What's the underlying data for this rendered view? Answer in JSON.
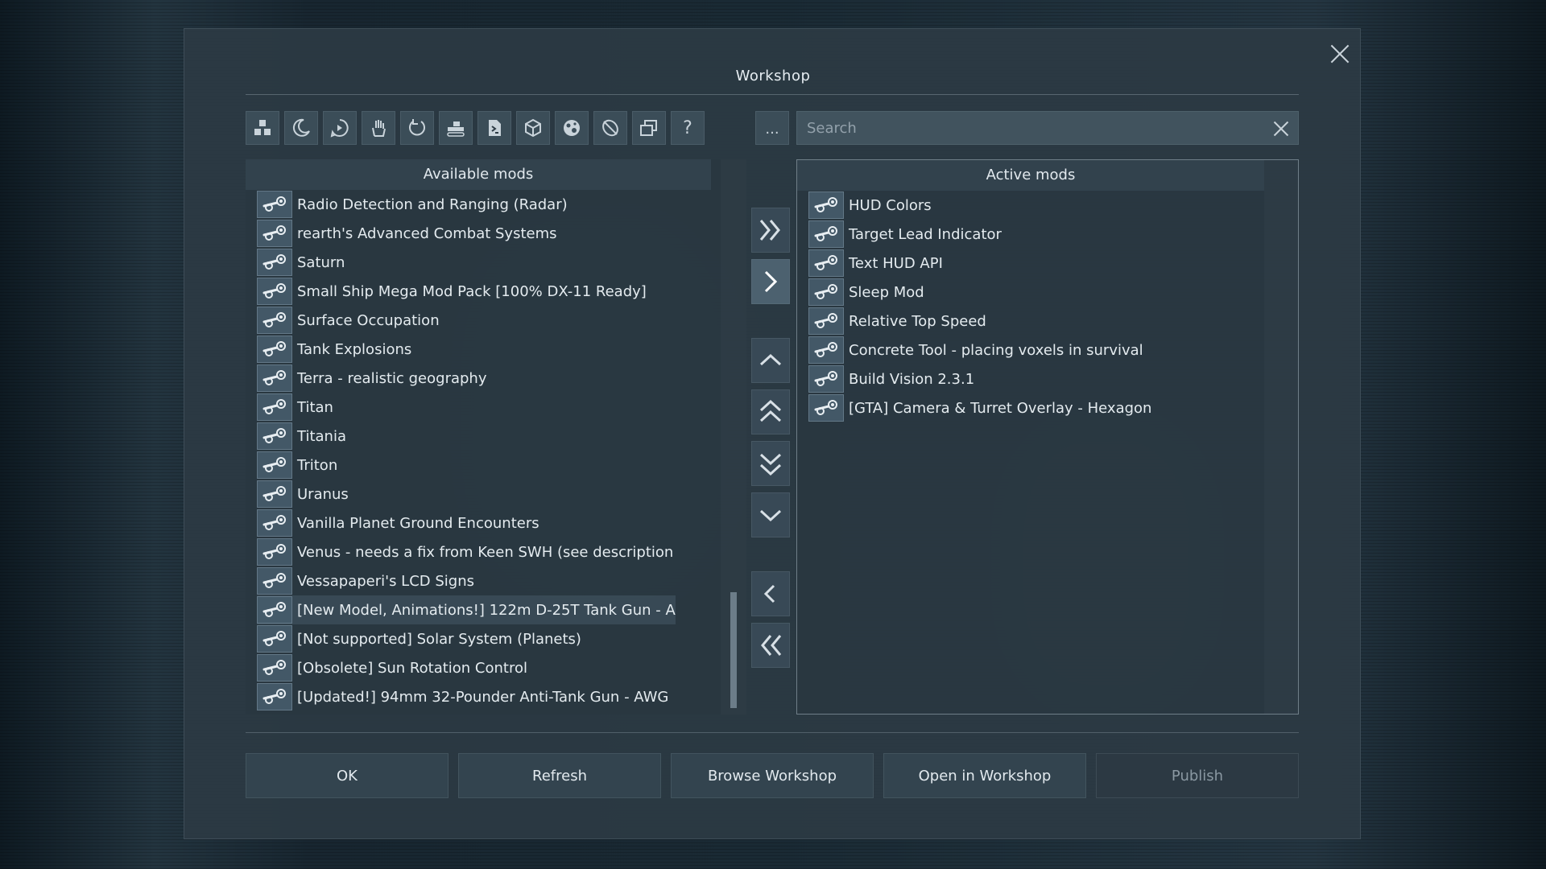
{
  "dialog": {
    "title": "Workshop",
    "close_icon": "close-icon"
  },
  "toolbar": {
    "tools": [
      {
        "name": "blocks-filter-icon"
      },
      {
        "name": "moon-filter-icon"
      },
      {
        "name": "chat-filter-icon"
      },
      {
        "name": "hand-filter-icon"
      },
      {
        "name": "refresh-filter-icon"
      },
      {
        "name": "tank-filter-icon"
      },
      {
        "name": "script-filter-icon"
      },
      {
        "name": "cube-filter-icon"
      },
      {
        "name": "planet-filter-icon"
      },
      {
        "name": "satellite-filter-icon"
      },
      {
        "name": "windows-filter-icon"
      },
      {
        "name": "help-icon",
        "glyph": "?"
      }
    ],
    "more_label": "..."
  },
  "search": {
    "placeholder": "Search",
    "value": ""
  },
  "available_mods": {
    "header": "Available mods",
    "items": [
      "Radio Detection and Ranging (Radar)",
      "rearth's Advanced Combat Systems",
      "Saturn",
      "Small Ship Mega Mod Pack [100% DX-11 Ready]",
      "Surface Occupation",
      "Tank Explosions",
      "Terra - realistic geography",
      "Titan",
      "Titania",
      "Triton",
      "Uranus",
      "Vanilla Planet Ground Encounters",
      "Venus - needs a fix from Keen SWH (see description",
      "Vessapaperi's LCD Signs",
      "[New Model, Animations!] 122m D-25T Tank Gun - A",
      "[Not supported] Solar System (Planets)",
      "[Obsolete] Sun Rotation Control",
      "[Updated!] 94mm 32-Pounder Anti-Tank Gun - AWG"
    ]
  },
  "active_mods": {
    "header": "Active mods",
    "items": [
      "HUD Colors",
      "Target Lead Indicator",
      "Text HUD API",
      "Sleep Mod",
      "Relative Top Speed",
      "Concrete Tool - placing voxels in survival",
      "Build Vision 2.3.1",
      "[GTA] Camera & Turret Overlay - Hexagon"
    ]
  },
  "move_buttons": [
    {
      "name": "add-all-button",
      "icon": "double-chevron-right-icon"
    },
    {
      "name": "add-selected-button",
      "icon": "chevron-right-icon"
    },
    {
      "name": "move-up-button",
      "icon": "chevron-up-icon"
    },
    {
      "name": "move-top-button",
      "icon": "double-chevron-up-icon"
    },
    {
      "name": "move-bottom-button",
      "icon": "double-chevron-down-icon"
    },
    {
      "name": "move-down-button",
      "icon": "chevron-down-icon"
    },
    {
      "name": "remove-selected-button",
      "icon": "chevron-left-icon"
    },
    {
      "name": "remove-all-button",
      "icon": "double-chevron-left-icon"
    }
  ],
  "buttons": {
    "ok": "OK",
    "refresh": "Refresh",
    "browse": "Browse Workshop",
    "open": "Open in Workshop",
    "publish": "Publish"
  },
  "colors": {
    "dialog_bg": "#2c3a44",
    "text": "#e4ebef",
    "panel_border": "#aab9c3"
  }
}
